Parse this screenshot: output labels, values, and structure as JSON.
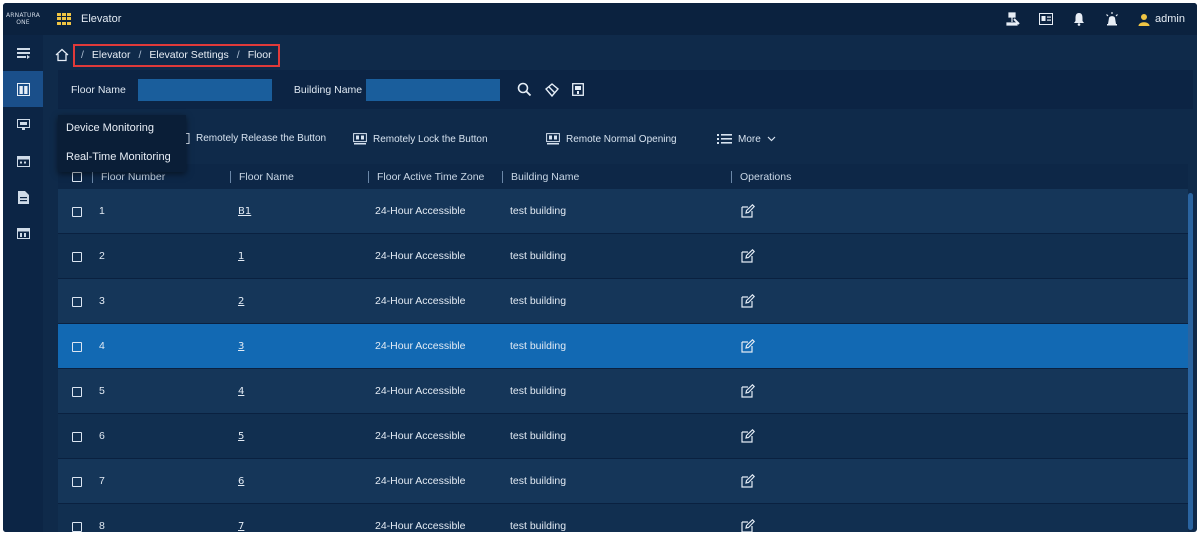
{
  "app": {
    "logo_line1": "ARNATURA",
    "logo_line2": "ONE",
    "title": "Elevator",
    "user": "admin"
  },
  "breadcrumb": [
    "Elevator",
    "Elevator Settings",
    "Floor"
  ],
  "filter": {
    "floor_name_label": "Floor Name",
    "floor_name_value": "",
    "building_name_label": "Building Name",
    "building_name_value": ""
  },
  "toolbar": {
    "release": "Remotely Release the Button",
    "lock": "Remotely Lock the Button",
    "normal": "Remote Normal Opening",
    "more": "More"
  },
  "dropdown": {
    "items": [
      "Device Monitoring",
      "Real-Time Monitoring"
    ]
  },
  "table": {
    "headers": {
      "floor_number": "Floor Number",
      "floor_name": "Floor Name",
      "time_zone": "Floor Active Time Zone",
      "building": "Building Name",
      "operations": "Operations"
    },
    "rows": [
      {
        "number": "1",
        "name": "B1",
        "zone": "24-Hour Accessible",
        "building": "test building"
      },
      {
        "number": "2",
        "name": "1",
        "zone": "24-Hour Accessible",
        "building": "test building"
      },
      {
        "number": "3",
        "name": "2",
        "zone": "24-Hour Accessible",
        "building": "test building"
      },
      {
        "number": "4",
        "name": "3",
        "zone": "24-Hour Accessible",
        "building": "test building"
      },
      {
        "number": "5",
        "name": "4",
        "zone": "24-Hour Accessible",
        "building": "test building"
      },
      {
        "number": "6",
        "name": "5",
        "zone": "24-Hour Accessible",
        "building": "test building"
      },
      {
        "number": "7",
        "name": "6",
        "zone": "24-Hour Accessible",
        "building": "test building"
      },
      {
        "number": "8",
        "name": "7",
        "zone": "24-Hour Accessible",
        "building": "test building"
      }
    ],
    "selected_row": 3
  },
  "colors": {
    "background": "#0f2a4a",
    "selected_row": "#1269b3",
    "input_fill": "#1a5e9c",
    "highlight_border": "#e03a3a",
    "accent_yellow": "#f0c544"
  }
}
